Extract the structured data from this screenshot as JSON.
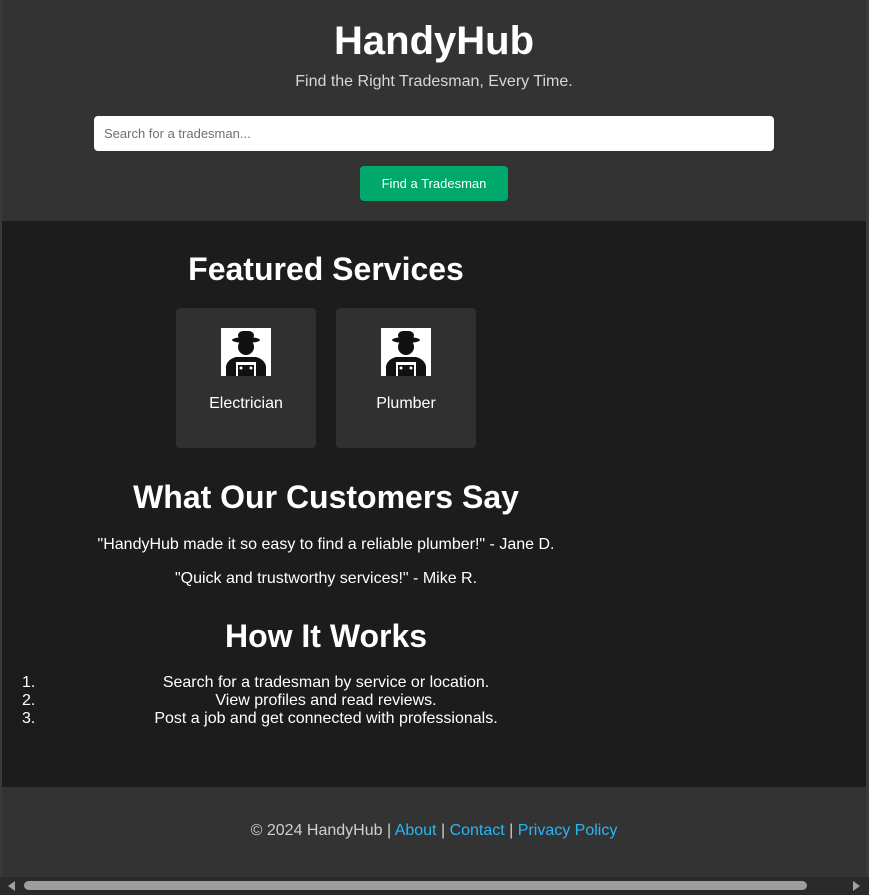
{
  "header": {
    "title": "HandyHub",
    "tagline": "Find the Right Tradesman, Every Time.",
    "search_placeholder": "Search for a tradesman...",
    "search_value": "",
    "find_button_label": "Find a Tradesman"
  },
  "featured": {
    "heading": "Featured Services",
    "services": [
      {
        "label": "Electrician",
        "icon": "tradesman-icon"
      },
      {
        "label": "Plumber",
        "icon": "tradesman-icon"
      }
    ]
  },
  "testimonials": {
    "heading": "What Our Customers Say",
    "quotes": [
      "\"HandyHub made it so easy to find a reliable plumber!\" - Jane D.",
      "\"Quick and trustworthy services!\" - Mike R."
    ]
  },
  "how_it_works": {
    "heading": "How It Works",
    "steps": [
      {
        "number": "1.",
        "text": "Search for a tradesman by service or location."
      },
      {
        "number": "2.",
        "text": "View profiles and read reviews."
      },
      {
        "number": "3.",
        "text": "Post a job and get connected with professionals."
      }
    ]
  },
  "footer": {
    "copyright": "© 2024 HandyHub",
    "separator": "|",
    "links": [
      "About",
      "Contact",
      "Privacy Policy"
    ]
  },
  "colors": {
    "accent_green": "#00a86b",
    "link_blue": "#29b6f6",
    "header_bg": "#333333",
    "main_bg": "#1c1c1c"
  }
}
